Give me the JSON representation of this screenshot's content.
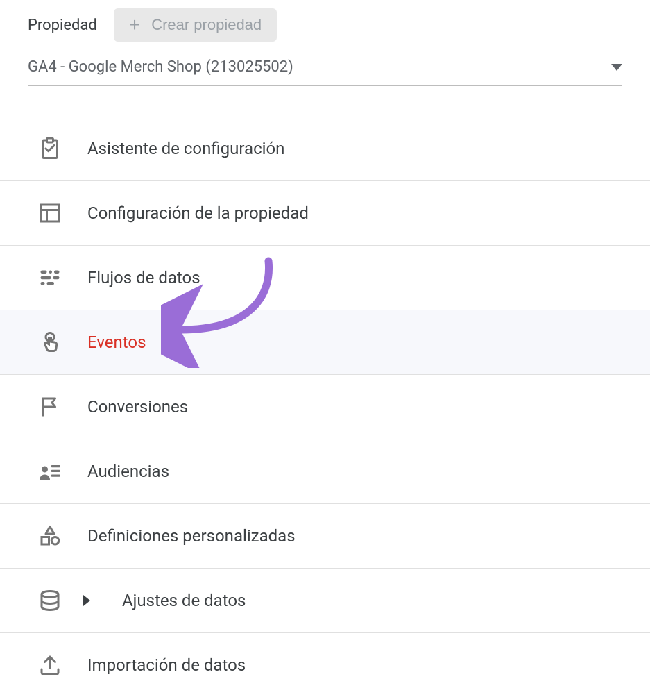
{
  "header": {
    "label": "Propiedad",
    "create_label": "Crear propiedad"
  },
  "property": {
    "name": "GA4 - Google Merch Shop (213025502)"
  },
  "menu": {
    "items": [
      {
        "label": "Asistente de configuración"
      },
      {
        "label": "Configuración de la propiedad"
      },
      {
        "label": "Flujos de datos"
      },
      {
        "label": "Eventos"
      },
      {
        "label": "Conversiones"
      },
      {
        "label": "Audiencias"
      },
      {
        "label": "Definiciones personalizadas"
      },
      {
        "label": "Ajustes de datos"
      },
      {
        "label": "Importación de datos"
      }
    ]
  },
  "colors": {
    "accent": "#d93025",
    "annotation": "#9a6dd7",
    "icon": "#757575"
  }
}
